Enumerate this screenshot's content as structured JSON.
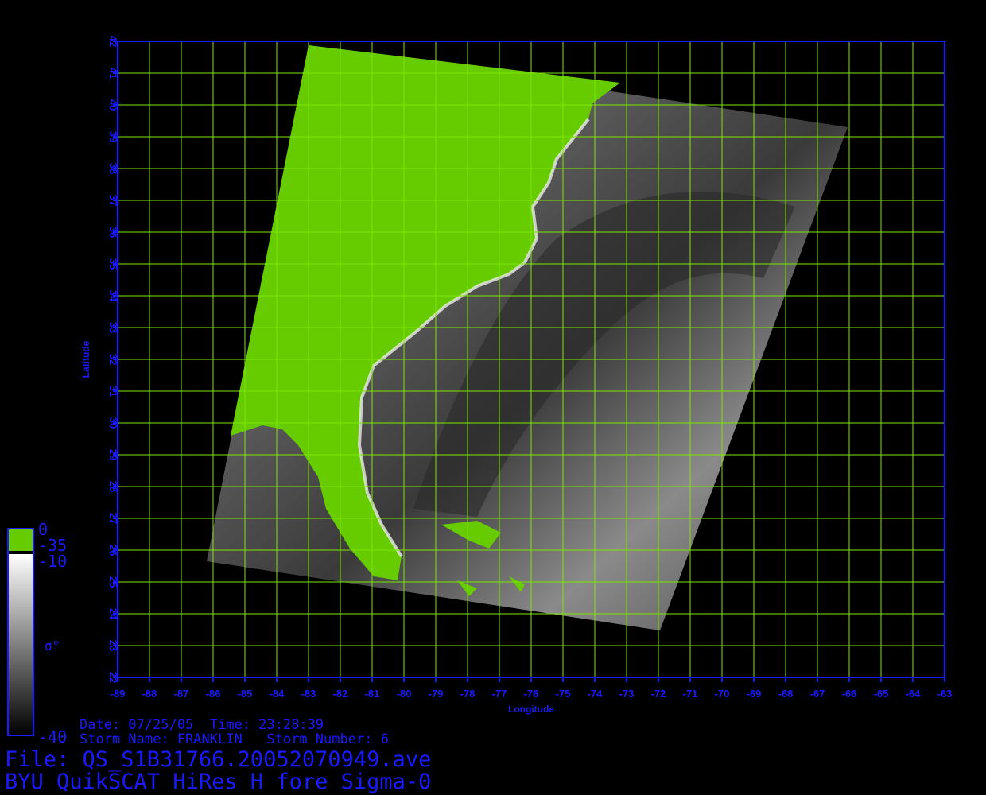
{
  "map": {
    "lon_ticks": [
      "-89",
      "-88",
      "-87",
      "-86",
      "-85",
      "-84",
      "-83",
      "-82",
      "-81",
      "-80",
      "-79",
      "-78",
      "-77",
      "-76",
      "-75",
      "-74",
      "-73",
      "-72",
      "-71",
      "-70",
      "-69",
      "-68",
      "-67",
      "-66",
      "-65",
      "-64",
      "-63"
    ],
    "lat_ticks": [
      "22",
      "23",
      "24",
      "25",
      "26",
      "27",
      "28",
      "29",
      "30",
      "31",
      "32",
      "33",
      "34",
      "35",
      "36",
      "37",
      "38",
      "39",
      "40",
      "41",
      "42"
    ],
    "lon_range": [
      -89,
      -63
    ],
    "lat_range": [
      22,
      42
    ],
    "x_label": "Longitude",
    "y_label": "Latitude",
    "colors": {
      "axis": "#1a1aff",
      "grid": "#7fe600",
      "land": "#66cc00"
    }
  },
  "colorbar": {
    "labels": {
      "top": "0",
      "land_low": "-35",
      "ocean_high": "-10",
      "bottom": "-40",
      "symbol": "σ°"
    },
    "colors": {
      "land": "#66cc00",
      "ocean_top": "#ffffff",
      "ocean_bottom": "#000000"
    }
  },
  "info": {
    "date_line": "Date: 07/25/05  Time: 23:28:39",
    "storm_line": "Storm Name: FRANKLIN   Storm Number: 6",
    "file_line": "File: QS_S1B31766.20052070949.ave",
    "product_line": "BYU QuikSCAT HiRes H fore Sigma-0"
  }
}
